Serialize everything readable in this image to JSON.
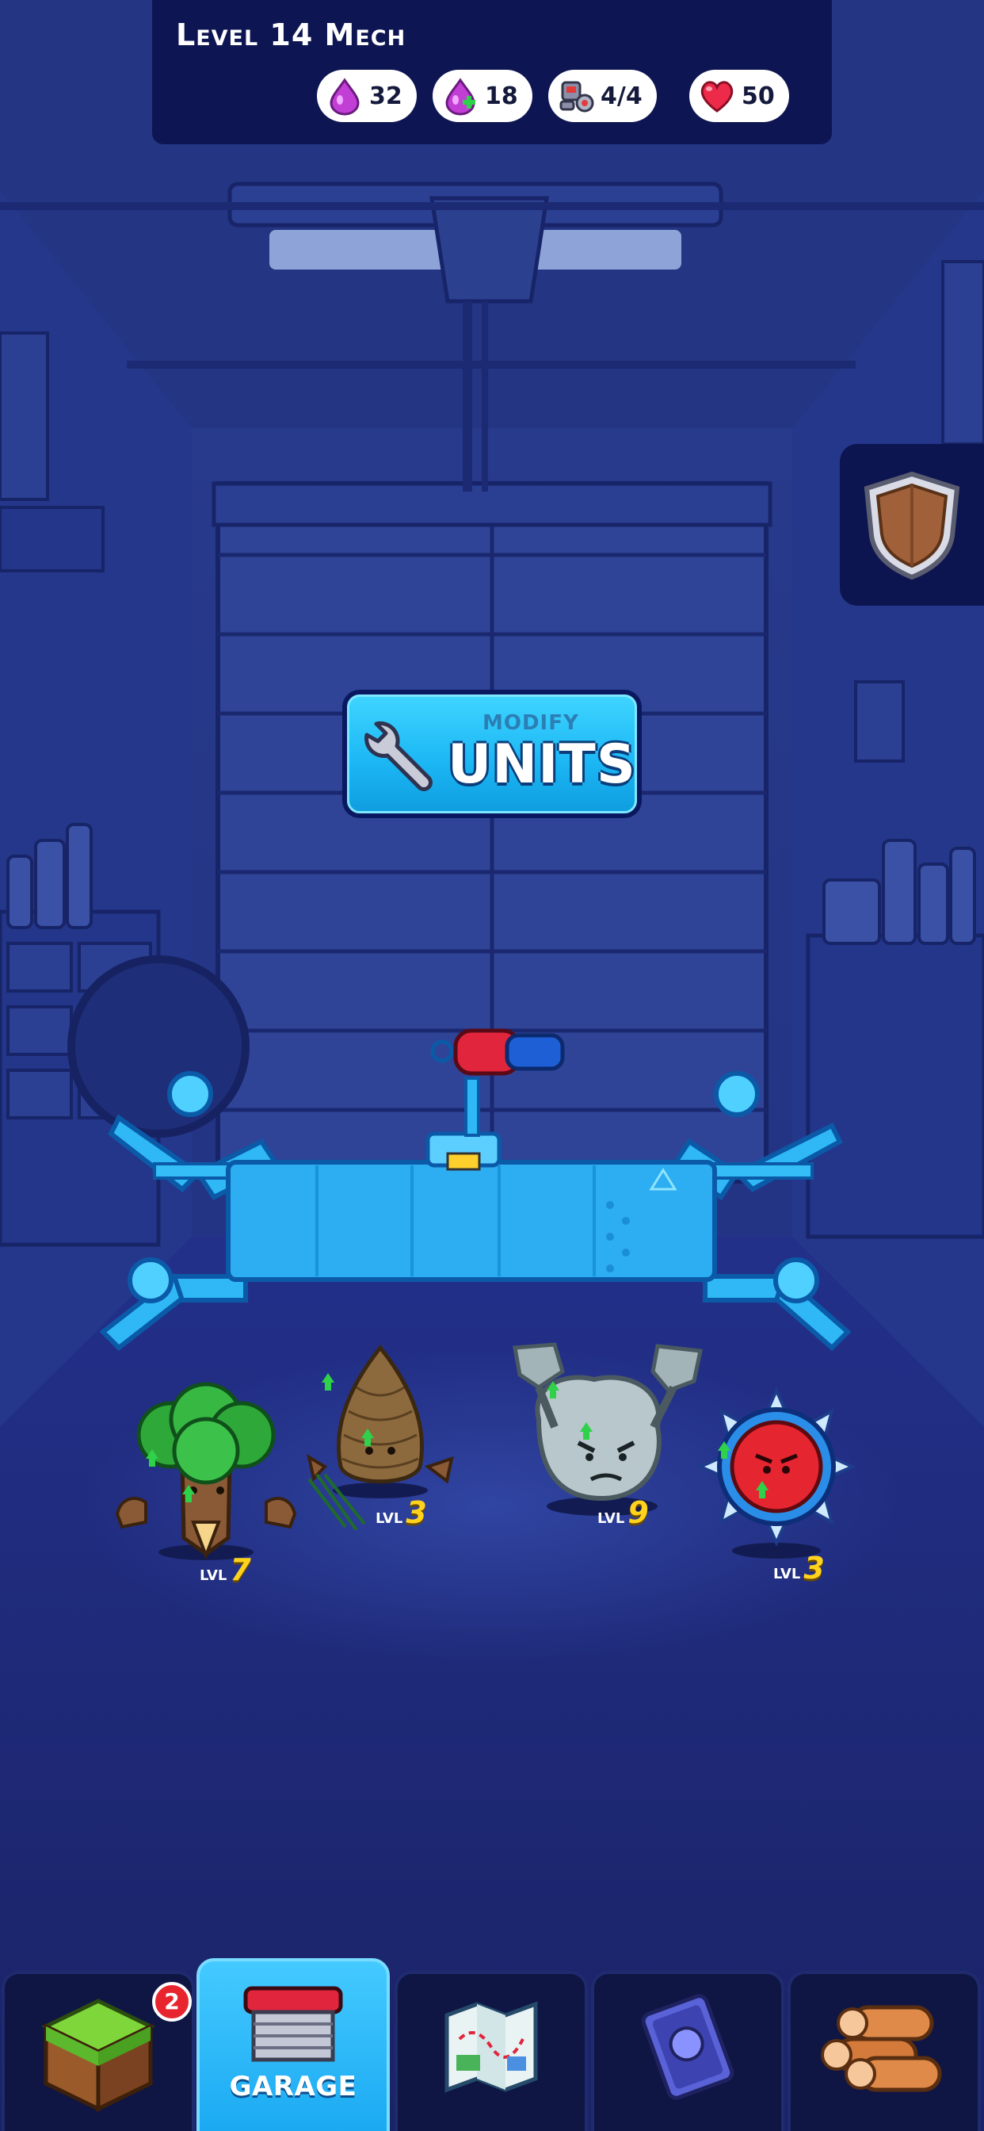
{
  "header": {
    "title": "Level 14 Mech",
    "resources": [
      {
        "icon": "purple-drop-icon",
        "value": "32"
      },
      {
        "icon": "purple-drop-plus-icon",
        "value": "18"
      },
      {
        "icon": "robot-parts-icon",
        "value": "4/4"
      },
      {
        "icon": "heart-icon",
        "value": "50"
      }
    ]
  },
  "modify_button": {
    "small_label": "MODIFY",
    "big_label": "UNITS"
  },
  "units": [
    {
      "name": "tree",
      "level_word": "LVL",
      "level": "7"
    },
    {
      "name": "pinecone",
      "level_word": "LVL",
      "level": "3"
    },
    {
      "name": "rock-golem",
      "level_word": "LVL",
      "level": "9"
    },
    {
      "name": "sawblade",
      "level_word": "LVL",
      "level": "3"
    }
  ],
  "nav": {
    "tabs": [
      {
        "icon": "grass-block-icon",
        "label": "",
        "badge": "2"
      },
      {
        "icon": "garage-icon",
        "label": "GARAGE",
        "active": true
      },
      {
        "icon": "map-icon",
        "label": ""
      },
      {
        "icon": "card-icon",
        "label": ""
      },
      {
        "icon": "logs-icon",
        "label": ""
      }
    ]
  },
  "colors": {
    "background": "#1c2a78",
    "header_bg": "#0d1652",
    "accent_blue": "#1db8f5",
    "level_yellow": "#ffd21c",
    "badge_red": "#e8252f"
  }
}
